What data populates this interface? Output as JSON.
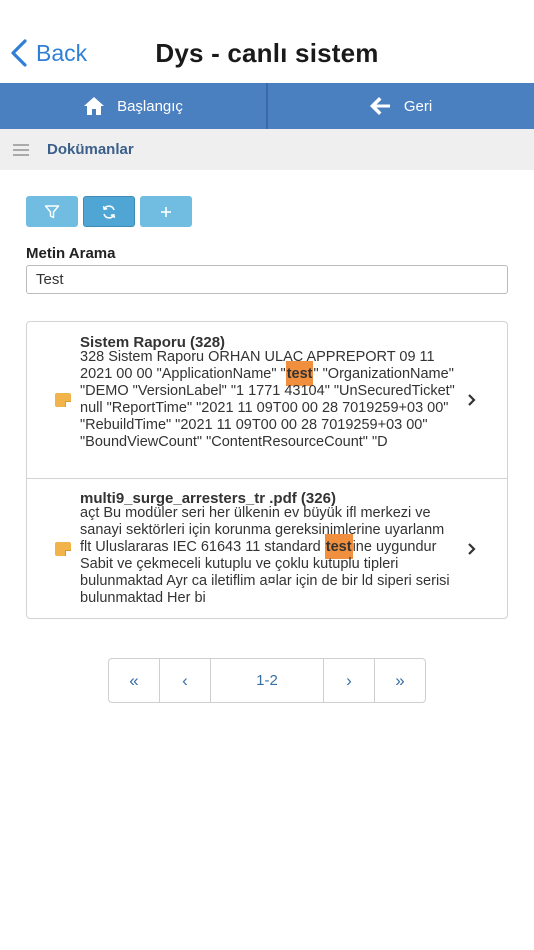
{
  "nav": {
    "back_label": "Back",
    "title": "Dys - canlı sistem"
  },
  "toolbar": {
    "home_label": "Başlangıç",
    "back_label": "Geri"
  },
  "crumb": {
    "title": "Dokümanlar"
  },
  "search": {
    "label": "Metin Arama",
    "value": "Test"
  },
  "results": [
    {
      "title": "Sistem Raporu (328)",
      "snippet_pre": "328 Sistem Raporu ORHAN ULAÇ APPREPORT 09 11 2021 00 00 \"ApplicationName\" \"",
      "highlight": "test",
      "snippet_post": "\" \"OrganizationName\" \"DEMO \"VersionLabel\" \"1 1771 43104\" \"UnSecuredTicket\" null \"ReportTime\" \"2021 11 09T00 00 28 7019259+03 00\" \"RebuildTime\" \"2021 11 09T00 00 28 7019259+03 00\" \"BoundViewCount\" \"ContentResourceCount\" \"D"
    },
    {
      "title": "multi9_surge_arresters_tr .pdf (326)",
      "snippet_pre": "açt Bu modüler seri her ülkenin ev büyük ifl merkezi ve sanayi sektörleri için korunma gereksinimlerine uyarlanm flt Uluslararas IEC 61643 11 standard ",
      "highlight": "test",
      "snippet_post": "ine uygundur Sabit ve çekmeceli kutuplu ve çoklu kutuplu tipleri bulunmaktad Ayr ca iletiflim a¤lar için de bir ld siperi serisi bulunmaktad Her bi"
    }
  ],
  "pager": {
    "first": "«",
    "prev": "‹",
    "info": "1-2",
    "next": "›",
    "last": "»"
  },
  "colors": {
    "accent": "#4a7fc0",
    "action": "#71bde2",
    "highlight": "#f0903e",
    "doc_icon": "#f0b44a",
    "link": "#2f7fd6"
  },
  "icons": {
    "back": "chevron-left-icon",
    "home": "home-icon",
    "toolbar_back": "arrow-left-icon",
    "menu": "hamburger-icon",
    "filter": "filter-icon",
    "refresh": "refresh-icon",
    "add": "plus-icon",
    "document": "document-icon",
    "row_open": "chevron-right-icon"
  }
}
